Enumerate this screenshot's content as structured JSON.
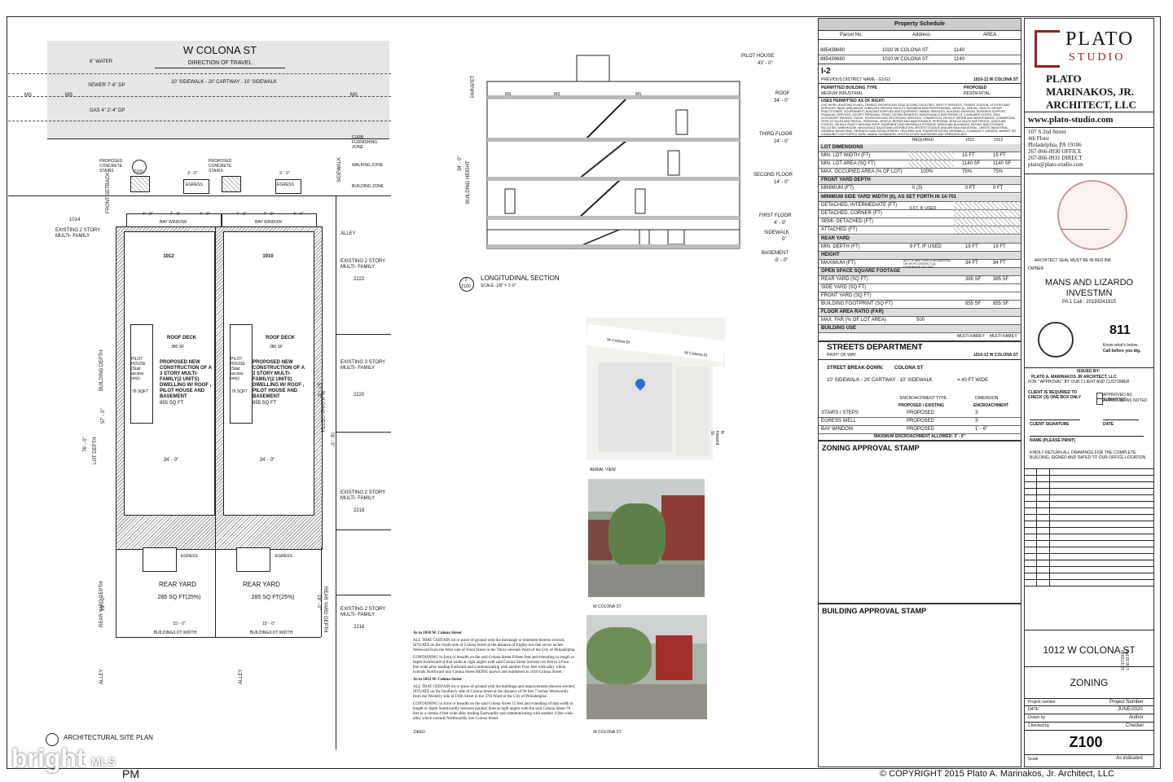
{
  "site_plan": {
    "street_name": "W COLONA ST",
    "direction": "DIRECTION OF TRAVEL",
    "utility_water": "6\" WATER",
    "utility_sewer": "SEWER 7'-6\" DP",
    "utility_gas": "GAS 4\" 2'-4\" DP",
    "ms": "MS",
    "sidewalk_note": "10' SIDEWALK - 20' CARTWAY - 10' SIDEWALK",
    "curb_zone": "CURB FURNISHING ZONE",
    "walking_zone": "WALKING ZONE",
    "building_zone": "BUILDING ZONE",
    "sidewalk": "SIDEWALK",
    "proposed_stairs": "PROPOSED CONCRETE STAIRS",
    "ref_tag": "Z100",
    "egress": "EGRESS",
    "bay_window": "BAY WINDOW",
    "front_setback": "FRONT SETBACK",
    "lot_left": "1014",
    "existing_left": "EXISTING 2 STORY MULTI- FAMILY",
    "alley": "ALLEY",
    "unit_a": "1012",
    "unit_b": "1010",
    "roof_deck": "ROOF DECK",
    "roof_deck_sf": "380 SF",
    "pilot_house": "PILOT HOUSE (Stair access only)",
    "pilot_sf": "76 SQFT",
    "proposed_text": "PROPOSED NEW CONSTRUCTION OF A 3 STORY MULTI-FAMILY(2 UNITS) DWELLING W/ ROOF , PILOT HOUSE AND BASEMENT",
    "area_sf": "855 SQ FT",
    "width_dim": "34' - 0\"",
    "rear_yard": "REAR YARD",
    "rear_yard_area": "285 SQ FT(25%)",
    "lot_width_dim": "15' - 0\"",
    "building_lot_width": "BUILDING/LOT WIDTH",
    "building_depth": "BUILDING DEPTH",
    "lot_depth": "LOT DEPTH",
    "rear_yard_depth": "REAR YARD DEPTH",
    "dim_76": "76' - 0\"",
    "dim_57": "57' - 0\"",
    "dim_19": "19' - 0\"",
    "dim_4": "4' - 0\"",
    "dim_7": "7' - 0\"",
    "dim_3": "3' - 0\"",
    "right_existing_2222": "EXISTING 2 STORY MULTI- FAMILY",
    "addr_2222": "2222",
    "right_existing_2220": "EXISTING 3 STORY MULTI- FAMILY",
    "addr_2220": "2220",
    "right_existing_2218": "EXISTING 2 STORY MULTI- FAMILY",
    "addr_2218": "2218",
    "right_existing_2216": "EXISTING 2 STORY MULTI- FAMILY",
    "addr_2216": "2216",
    "plan_title": "ARCHITECTURAL SITE PLAN"
  },
  "section": {
    "title": "LONGITUDINAL SECTION",
    "scale": "SCALE: 1/8\" = 1'-0\"",
    "tag_num": "2",
    "tag_ref": "Z100",
    "levels": [
      {
        "name": "PILOT HOUSE",
        "elev": "43' - 0\""
      },
      {
        "name": "ROOF",
        "elev": "34' - 0\""
      },
      {
        "name": "THIRD FLOOR",
        "elev": "24' - 0\""
      },
      {
        "name": "SECOND FLOOR",
        "elev": "14' - 0\""
      },
      {
        "name": "FIRST FLOOR",
        "elev": "4' - 0\""
      },
      {
        "name": "SIDEWALK",
        "elev": "0\""
      },
      {
        "name": "BASEMENT",
        "elev": "-5' - 0\""
      }
    ],
    "building_height": "BUILDING HEIGHT",
    "bh_dim": "34' - 0\"",
    "parapet": "PARAPET",
    "ms": "MS"
  },
  "aerial": {
    "caption": "AERIAL VIEW",
    "street1": "W Colona St",
    "street2": "W Colona St",
    "street3": "N Howard St"
  },
  "photos": [
    {
      "caption": "W COLONA ST"
    },
    {
      "caption": "W COLONA ST"
    }
  ],
  "deed": {
    "caption": "DEED",
    "h1": "As to 1010 W. Colona Street",
    "p1": "ALL THAT CERTAIN lot or piece of ground with the messuage or tenement thereon erected, SITUATE on the South side of Colona Street at the distance of Eighty-one feet seven inches Westward from the West side of Front Street in the Thirty-seventh Ward of the City of Philadelphia.",
    "p2": "CONTAINING in front or breadth on the said Colona Street Fifteen feet and extending in length or depth Southward of that width at right angles with said Colona Street Seventy-six feet to a Four feet wide alley leading Eastward and communicating with another Four feet wide alley which extends Northward into Colona Street BEING known and numbered as 1010 Colona Street.",
    "h2": "As to 1012 W. Colona Street",
    "p3": "ALL THAT CERTAIN lot or piece of ground with the buildings and improvements thereon erected, SITUATE on the Southerly side of Colona Street at the distance of 96 feet 7 inches Westwardly from the Westerly side of Fifth Street in the 37th Ward of the City of Philadelphia.",
    "p4": "CONTAINING in front or breadth on the said Colona Street 15 feet and extending of that width in length or depth Southwardly between parallel lines at right angles with the said Colona Street 76 feet to a certain 4 feet wide alley leading Eastwardly and communicating with another 4 feet wide alley which extends Northwardly into Colona Street."
  },
  "schedule": {
    "title": "Property Schedule",
    "headers": [
      "Parcel No.",
      "Address",
      "AREA"
    ],
    "rows": [
      [
        "885439680",
        "1010 W COLONA ST",
        "1140"
      ],
      [
        "885439680",
        "1010 W COLONA ST",
        "1140"
      ]
    ],
    "zone": "I-2",
    "prev_district": "PREVIOUS DISTRICT NAME - G1/G2",
    "address_ref": "1010-12 W COLONA ST",
    "permitted_type": "PERMITTED BUILDING TYPE",
    "permitted_val": "MEDIUM INDUSTRIAL",
    "proposed": "PROPOSED",
    "proposed_val": "RESIDENTIAL",
    "uses_title": "USES PERMITTED AS OF RIGHT:",
    "uses_text": "LIVE-WORK (EXISTING PLANS), TRANSIT, RECREATION, EDUCATIONAL FACILITIES, SAFETY SERVICES, TRANSIT STATION, UTILITIES AND SERVICES, BASIC AND MAJOR, WIRELESS SERVICE FACILITY, BUSINESS AND PROFESSIONAL, MEDICAL, DENTAL, HEALTH GROUP PRACTITIONER, GOVERNMENT, BUILDING SUPPLIES AND EQUIPMENT, ANIMAL SERVICES, BUILDING SERVICES, BUSINESS SUPPORT, FINANCIAL SERVICES, EXCEPT PERSONAL CREDIT ESTABLISHMENTS, MAINTENANCE AND REPAIR OF CONSUMER GOODS, NON-ACCESSORY PARKING, RADIO, TELEVISION AND RECORDING SERVICES, COMMERCIAL VEHICLE REPAIR AND MAINTENANCE, COMMERCIAL VEHICLE SALES AND RENTAL, PERSONAL VEHICLE REPAIR AND MAINTENANCE, PERSONAL VEHICLE SALES AND RENTAL, GASOLINE STATION, VEHICLE PAINT FINISHING SHOP, EQUIPMENT AND MATERIALS STORAGE YARDS AND BUILDINGS, MOVING AND STORAGE FACILITIES, WAREHOUSE, WHOLESALE SALES AND DISTRIBUTION, ARTISTS STUDIOS AND ARTISAN INDUSTRIAL, LIMITED INDUSTRIAL, GENERAL INDUSTRIAL, RESEARCH AND DEVELOPMENT, TRUCKING AND TRANSPORTATION TERMINALS, COMMUNITY GARDEN, MARKET OR COMMUNITY-SUPPORTED FARM, ANIMAL HUSBANDRY, HORTICULTURE NURSERIES AND GREENHOUSES",
    "col_required": "REQUIRED",
    "col_1010": "1010",
    "col_1012": "1012",
    "lot_dims": "LOT DIMENSIONS",
    "lines": [
      {
        "label": "MIN. LOT WIDTH (FT)",
        "req": "",
        "a": "15 FT",
        "b": "15 FT",
        "hatch": true
      },
      {
        "label": "MIN. LOT AREA (SQ FT)",
        "req": "",
        "a": "1140 SF",
        "b": "1140 SF",
        "hatch": true
      },
      {
        "label": "MAX. OCCUPIED AREA (% OF LOT)",
        "req": "100%",
        "a": "75%",
        "b": "75%",
        "hatch": false
      }
    ],
    "front_yard": "FRONT YARD DEPTH",
    "front_min": [
      "MINIMUM (FT)",
      "0 (3)",
      "0 FT",
      "0 FT"
    ],
    "min_side": "MINIMUM SIDE YARD WIDTH (6), AS SET FORTH IN 14-701",
    "side_rows": [
      "DETACHED, INTERMEDIATE (FT)",
      "DETACHED, CORNER (FT)",
      "SEMI- DETACHED (FT)",
      "ATTACHED (FT)"
    ],
    "side_req": "6 FT, IF USED",
    "rear_yard": "REAR YARD",
    "rear_min": [
      "MIN. DEPTH (FT)",
      "8 FT, IF USED",
      "19 FT",
      "19 FT"
    ],
    "height": "HEIGHT",
    "height_max": [
      "MAXIMUM (FT)",
      "60 FT IF ABUTTING A RESIDENTIAL OR SP-PO DISTRICT (3), OTHERWISE NO LIMIT",
      "34 FT",
      "34 FT"
    ],
    "open_space": "OPEN SPACE SQUARE FOOTAGE",
    "os_rows": [
      [
        "REAR YARD (SQ FT)",
        "385 SF",
        "385 SF"
      ],
      [
        "SIDE YARD (SQ FT)",
        "",
        ""
      ],
      [
        "FRONT YARD (SQ FT)",
        "",
        ""
      ],
      [
        "BUILDING FOOTPRINT (SQ FT)",
        "855 SF",
        "855 SF"
      ]
    ],
    "far": "FLOOR AREA RATIO (FAR)",
    "far_row": [
      "MAX. FAR (% OF LOT AREA)",
      "500"
    ],
    "building_use": "BUILDING USE",
    "use_vals": [
      "MULTI-FAMILY",
      "MULTI-FAMILY"
    ]
  },
  "streets": {
    "title": "STREETS DEPARTMENT",
    "row": "RIGHT OF WAY",
    "addr": "1010-12 W COLONA ST",
    "breakdown_label": "STREET BREAK-DOWN:",
    "breakdown_street": "COLONA ST",
    "breakdown_dims": "10' SIDEWALK - 20' CARTWAY - 10' SIDEWALK",
    "breakdown_total": "= 40 FT WIDE",
    "enc_type": "ENCROACHMENT TYPE",
    "dimension": "DIMENSION",
    "prop_exist": "PROPOSED / EXISTING",
    "encroachment": "ENCROACHMENT",
    "enc_rows": [
      [
        "STAIRS / STEPS",
        "PROPOSED",
        "3'"
      ],
      [
        "EGRESS WELL",
        "PROPOSED",
        "3'"
      ],
      [
        "BAY WINDOW",
        "PROPOSED",
        "1' - 6\""
      ]
    ],
    "max_enc": "MAXIMUM ENCROACHMENT ALLOWED: 3' - 6\""
  },
  "stamps": {
    "zoning": "ZONING APPROVAL STAMP",
    "building": "BUILDING APPROVAL STAMP"
  },
  "title_block": {
    "logo_plato": "PLATO",
    "logo_studio": "STUDIO",
    "firm1": "PLATO",
    "firm2": "MARINAKOS, JR.",
    "firm3": "ARCHITECT, LLC",
    "web": "www.plato-studio.com",
    "addr1": "107 S 2nd Street",
    "addr2": "4th Floor",
    "addr3": "Philadelphia, PA 19106",
    "phone1": "267-866-0930 OFFICE",
    "phone2": "267-866-0931 DIRECT",
    "email": "plato@plato-studio.com",
    "seal_note": "ARCHITECT SEAL MUST BE IN RED INK",
    "owner_label": "OWNER",
    "owner1": "MANS AND LIZARDO",
    "owner2": "INVESTMN",
    "pa1": "PA 1 Call : 20193241915",
    "call811": "811",
    "call_text1": "Know what's below.",
    "call_text2": "Call before you dig.",
    "issued_by": "ISSUED BY:",
    "issued_firm": "PLATO A. MARINAKOS JR ARCHITECT, LLC",
    "issued_for": "FOR \" APPROVAL\" BY OUR CLIENT AND CUSTOMER",
    "client_req": "CLIENT IS REQUIRED TO CHECK (X) ONE BOX ONLY",
    "approved_sub": "APPROVED AS SUBMITTED",
    "approved_noted": "APPROVED AS NOTED",
    "client_sig": "CLIENT SIGNATURE",
    "date": "DATE",
    "name_print": "NAME (PLEASE PRINT)",
    "return_note": "KINDLY RETURN ALL DRAWINGS FOR THE COMPLETE BUILDING, SIGNED AND DATED TO OUR OFFICE LOCATION.",
    "project_addr": "1012 W COLONA ST",
    "sheet_title": "ZONING",
    "proj_num_label": "Project number",
    "proj_num_val": "Project Number",
    "date_val": "JUNE/2020",
    "drawn_label": "Drawn by",
    "drawn_val": "Author",
    "checked_label": "Checked by",
    "checked_val": "Checker",
    "sheet_num": "Z100",
    "scale_label": "Scale",
    "scale_val": "As indicated",
    "timestamp": "12/17/2024 1:56:33 PM"
  },
  "footer": {
    "copyright": "© COPYRIGHT 2015  Plato A. Marinakos, Jr. Architect, LLC",
    "pm": "PM",
    "watermark": "bright",
    "mls": "MLS"
  }
}
